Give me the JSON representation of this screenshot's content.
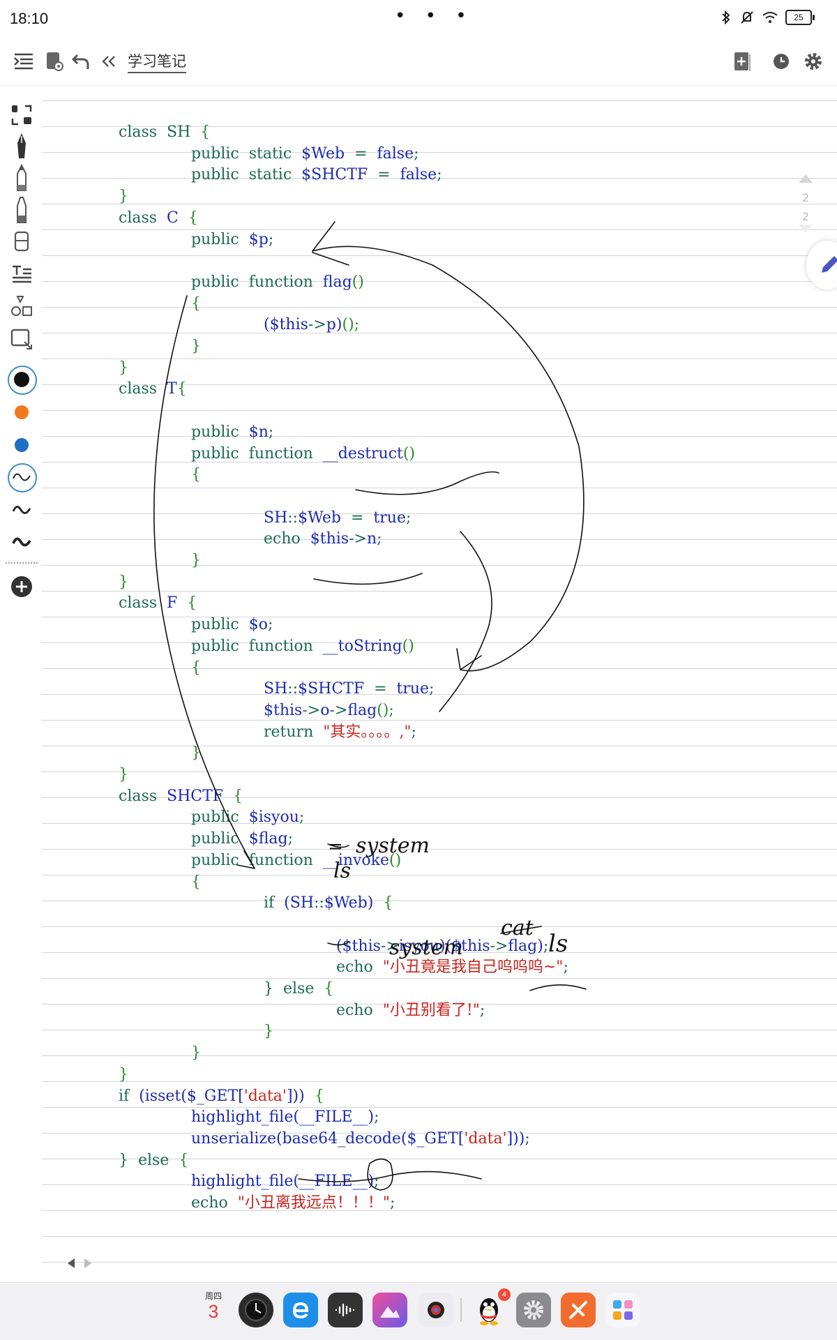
{
  "status": {
    "time": "18:10",
    "dots": "• • •",
    "battery": "25"
  },
  "header": {
    "title": "学习笔记"
  },
  "icons": {
    "toolbar": [
      "outline-icon",
      "notebook-icon",
      "undo-icon",
      "collapse-icon",
      "add-page-icon",
      "history-icon",
      "gear-icon"
    ],
    "sidebar": [
      "lasso-icon",
      "fountain-pen-icon",
      "pencil-icon",
      "highlighter-icon",
      "eraser-icon",
      "text-icon",
      "shapes-icon",
      "image-icon"
    ]
  },
  "colors": {
    "black": "#111111",
    "orange": "#f2781e",
    "blue": "#1f6fc5",
    "keyword": "#1d6a55",
    "variable": "#1c2bb0",
    "string": "#c8241d"
  },
  "page_indicator": {
    "current": "2",
    "total": "2"
  },
  "code_lines": [
    {
      "indent": 0,
      "y": 0,
      "tokens": [
        {
          "t": "class  SH  ",
          "c": "kw"
        },
        {
          "t": "{",
          "c": "pn"
        }
      ]
    },
    {
      "indent": 1,
      "y": 1,
      "tokens": [
        {
          "t": "public  static  ",
          "c": "kw"
        },
        {
          "t": "$Web",
          "c": "vr"
        },
        {
          "t": "  =  ",
          "c": "kw"
        },
        {
          "t": "false",
          "c": "vr"
        },
        {
          "t": ";",
          "c": "kw"
        }
      ]
    },
    {
      "indent": 1,
      "y": 2,
      "tokens": [
        {
          "t": "public  static  ",
          "c": "kw"
        },
        {
          "t": "$SHCTF",
          "c": "vr"
        },
        {
          "t": "  =  ",
          "c": "kw"
        },
        {
          "t": "false",
          "c": "vr"
        },
        {
          "t": ";",
          "c": "kw"
        }
      ]
    },
    {
      "indent": 0,
      "y": 3,
      "tokens": [
        {
          "t": "}",
          "c": "pn"
        }
      ]
    },
    {
      "indent": 0,
      "y": 4,
      "tokens": [
        {
          "t": "class  ",
          "c": "kw"
        },
        {
          "t": "C",
          "c": "vr"
        },
        {
          "t": "  {",
          "c": "pn"
        }
      ]
    },
    {
      "indent": 1,
      "y": 5,
      "tokens": [
        {
          "t": "public  ",
          "c": "kw"
        },
        {
          "t": "$p",
          "c": "vr"
        },
        {
          "t": ";",
          "c": "kw"
        }
      ]
    },
    {
      "indent": 1,
      "y": 7,
      "tokens": [
        {
          "t": "public  function  ",
          "c": "kw"
        },
        {
          "t": "flag",
          "c": "vr"
        },
        {
          "t": "()",
          "c": "pn"
        }
      ]
    },
    {
      "indent": 1,
      "y": 8,
      "tokens": [
        {
          "t": "{",
          "c": "pn"
        }
      ]
    },
    {
      "indent": 2,
      "y": 9,
      "tokens": [
        {
          "t": "($this",
          "c": "vr"
        },
        {
          "t": "->",
          "c": "kw"
        },
        {
          "t": "p",
          "c": "vr"
        },
        {
          "t": ")",
          "c": "vr"
        },
        {
          "t": "();",
          "c": "pn"
        }
      ]
    },
    {
      "indent": 1,
      "y": 10,
      "tokens": [
        {
          "t": "}",
          "c": "pn"
        }
      ]
    },
    {
      "indent": 0,
      "y": 11,
      "tokens": [
        {
          "t": "}",
          "c": "pn"
        }
      ]
    },
    {
      "indent": 0,
      "y": 12,
      "tokens": [
        {
          "t": "class  ",
          "c": "kw"
        },
        {
          "t": "T",
          "c": "vr"
        },
        {
          "t": "{",
          "c": "pn"
        }
      ]
    },
    {
      "indent": 1,
      "y": 14,
      "tokens": [
        {
          "t": "public  ",
          "c": "kw"
        },
        {
          "t": "$n",
          "c": "vr"
        },
        {
          "t": ";",
          "c": "kw"
        }
      ]
    },
    {
      "indent": 1,
      "y": 15,
      "tokens": [
        {
          "t": "public  function  ",
          "c": "kw"
        },
        {
          "t": "__destruct",
          "c": "vr"
        },
        {
          "t": "()",
          "c": "pn"
        }
      ]
    },
    {
      "indent": 1,
      "y": 16,
      "tokens": [
        {
          "t": "{",
          "c": "pn"
        }
      ]
    },
    {
      "indent": 2,
      "y": 18,
      "tokens": [
        {
          "t": "SH",
          "c": "vr"
        },
        {
          "t": "::",
          "c": "kw"
        },
        {
          "t": "$Web",
          "c": "vr"
        },
        {
          "t": "  =  ",
          "c": "kw"
        },
        {
          "t": "true",
          "c": "vr"
        },
        {
          "t": ";",
          "c": "kw"
        }
      ]
    },
    {
      "indent": 2,
      "y": 19,
      "tokens": [
        {
          "t": "echo  ",
          "c": "kw"
        },
        {
          "t": "$this",
          "c": "vr"
        },
        {
          "t": "->",
          "c": "kw"
        },
        {
          "t": "n",
          "c": "vr"
        },
        {
          "t": ";",
          "c": "kw"
        }
      ]
    },
    {
      "indent": 1,
      "y": 20,
      "tokens": [
        {
          "t": "}",
          "c": "pn"
        }
      ]
    },
    {
      "indent": 0,
      "y": 21,
      "tokens": [
        {
          "t": "}",
          "c": "pn"
        }
      ]
    },
    {
      "indent": 0,
      "y": 22,
      "tokens": [
        {
          "t": "class  ",
          "c": "kw"
        },
        {
          "t": "F",
          "c": "vr"
        },
        {
          "t": "  {",
          "c": "pn"
        }
      ]
    },
    {
      "indent": 1,
      "y": 23,
      "tokens": [
        {
          "t": "public  ",
          "c": "kw"
        },
        {
          "t": "$o",
          "c": "vr"
        },
        {
          "t": ";",
          "c": "kw"
        }
      ]
    },
    {
      "indent": 1,
      "y": 24,
      "tokens": [
        {
          "t": "public  function  ",
          "c": "kw"
        },
        {
          "t": "__toString",
          "c": "vr"
        },
        {
          "t": "()",
          "c": "pn"
        }
      ]
    },
    {
      "indent": 1,
      "y": 25,
      "tokens": [
        {
          "t": "{",
          "c": "pn"
        }
      ]
    },
    {
      "indent": 2,
      "y": 26,
      "tokens": [
        {
          "t": "SH",
          "c": "vr"
        },
        {
          "t": "::",
          "c": "kw"
        },
        {
          "t": "$SHCTF",
          "c": "vr"
        },
        {
          "t": "  =  ",
          "c": "kw"
        },
        {
          "t": "true",
          "c": "vr"
        },
        {
          "t": ";",
          "c": "kw"
        }
      ]
    },
    {
      "indent": 2,
      "y": 27,
      "tokens": [
        {
          "t": "$this",
          "c": "vr"
        },
        {
          "t": "->",
          "c": "kw"
        },
        {
          "t": "o",
          "c": "vr"
        },
        {
          "t": "->",
          "c": "kw"
        },
        {
          "t": "flag",
          "c": "vr"
        },
        {
          "t": "();",
          "c": "pn"
        }
      ]
    },
    {
      "indent": 2,
      "y": 28,
      "tokens": [
        {
          "t": "return  ",
          "c": "kw"
        },
        {
          "t": "\"其实。。。。,\"",
          "c": "st"
        },
        {
          "t": ";",
          "c": "kw"
        }
      ]
    },
    {
      "indent": 1,
      "y": 29,
      "tokens": [
        {
          "t": "}",
          "c": "pn"
        }
      ]
    },
    {
      "indent": 0,
      "y": 30,
      "tokens": [
        {
          "t": "}",
          "c": "pn"
        }
      ]
    },
    {
      "indent": 0,
      "y": 31,
      "tokens": [
        {
          "t": "class  ",
          "c": "kw"
        },
        {
          "t": "SHCTF",
          "c": "vr"
        },
        {
          "t": "  {",
          "c": "pn"
        }
      ]
    },
    {
      "indent": 1,
      "y": 32,
      "tokens": [
        {
          "t": "public  ",
          "c": "kw"
        },
        {
          "t": "$isyou",
          "c": "vr"
        },
        {
          "t": ";",
          "c": "kw"
        }
      ]
    },
    {
      "indent": 1,
      "y": 33,
      "tokens": [
        {
          "t": "public  ",
          "c": "kw"
        },
        {
          "t": "$flag",
          "c": "vr"
        },
        {
          "t": ";",
          "c": "kw"
        }
      ]
    },
    {
      "indent": 1,
      "y": 34,
      "tokens": [
        {
          "t": "public  function  ",
          "c": "kw"
        },
        {
          "t": "__invoke",
          "c": "vr"
        },
        {
          "t": "()",
          "c": "pn"
        }
      ]
    },
    {
      "indent": 1,
      "y": 35,
      "tokens": [
        {
          "t": "{",
          "c": "pn"
        }
      ]
    },
    {
      "indent": 2,
      "y": 36,
      "tokens": [
        {
          "t": "if  ",
          "c": "kw"
        },
        {
          "t": "(SH",
          "c": "vr"
        },
        {
          "t": "::",
          "c": "kw"
        },
        {
          "t": "$Web)",
          "c": "vr"
        },
        {
          "t": "  {",
          "c": "pn"
        }
      ]
    },
    {
      "indent": 3,
      "y": 38,
      "tokens": [
        {
          "t": "($this",
          "c": "vr"
        },
        {
          "t": "->",
          "c": "kw"
        },
        {
          "t": "isyou)",
          "c": "vr"
        },
        {
          "t": "($this",
          "c": "vr"
        },
        {
          "t": "->",
          "c": "kw"
        },
        {
          "t": "flag)",
          "c": "vr"
        },
        {
          "t": ";",
          "c": "kw"
        }
      ]
    },
    {
      "indent": 3,
      "y": 39,
      "tokens": [
        {
          "t": "echo  ",
          "c": "kw"
        },
        {
          "t": "\"小丑竟是我自己呜呜呜~\"",
          "c": "st"
        },
        {
          "t": ";",
          "c": "kw"
        }
      ]
    },
    {
      "indent": 2,
      "y": 40,
      "tokens": [
        {
          "t": "}  else  ",
          "c": "kw"
        },
        {
          "t": "{",
          "c": "pn"
        }
      ]
    },
    {
      "indent": 3,
      "y": 41,
      "tokens": [
        {
          "t": "echo  ",
          "c": "kw"
        },
        {
          "t": "\"小丑别看了!\"",
          "c": "st"
        },
        {
          "t": ";",
          "c": "kw"
        }
      ]
    },
    {
      "indent": 2,
      "y": 42,
      "tokens": [
        {
          "t": "}",
          "c": "pn"
        }
      ]
    },
    {
      "indent": 1,
      "y": 43,
      "tokens": [
        {
          "t": "}",
          "c": "pn"
        }
      ]
    },
    {
      "indent": 0,
      "y": 44,
      "tokens": [
        {
          "t": "}",
          "c": "pn"
        }
      ]
    },
    {
      "indent": 0,
      "y": 45,
      "tokens": [
        {
          "t": "if  ",
          "c": "kw"
        },
        {
          "t": "(isset($_GET[",
          "c": "vr"
        },
        {
          "t": "'data'",
          "c": "st"
        },
        {
          "t": "]))  ",
          "c": "vr"
        },
        {
          "t": "{",
          "c": "pn"
        }
      ]
    },
    {
      "indent": 1,
      "y": 46,
      "tokens": [
        {
          "t": "highlight_file(__FILE__)",
          "c": "vr"
        },
        {
          "t": ";",
          "c": "kw"
        }
      ]
    },
    {
      "indent": 1,
      "y": 47,
      "tokens": [
        {
          "t": "unserialize(base64_decode($_GET[",
          "c": "vr"
        },
        {
          "t": "'data'",
          "c": "st"
        },
        {
          "t": "]))",
          "c": "vr"
        },
        {
          "t": ";",
          "c": "kw"
        }
      ]
    },
    {
      "indent": 0,
      "y": 48,
      "tokens": [
        {
          "t": "}  else  ",
          "c": "kw"
        },
        {
          "t": "{",
          "c": "pn"
        }
      ]
    },
    {
      "indent": 1,
      "y": 49,
      "tokens": [
        {
          "t": "highlight_file(__FILE__)",
          "c": "vr"
        },
        {
          "t": ";",
          "c": "kw"
        }
      ]
    },
    {
      "indent": 1,
      "y": 50,
      "tokens": [
        {
          "t": "echo  ",
          "c": "kw"
        },
        {
          "t": "\"小丑离我远点！！！\"",
          "c": "st"
        },
        {
          "t": ";",
          "c": "kw"
        }
      ]
    }
  ],
  "handwriting": {
    "system_1": "system",
    "system_2": "system",
    "eq": "=",
    "ls_1": "ls",
    "cat": "cat",
    "ls_2": "ls"
  },
  "dock": {
    "day": "周四",
    "date": "3",
    "qq_badge": "4"
  }
}
